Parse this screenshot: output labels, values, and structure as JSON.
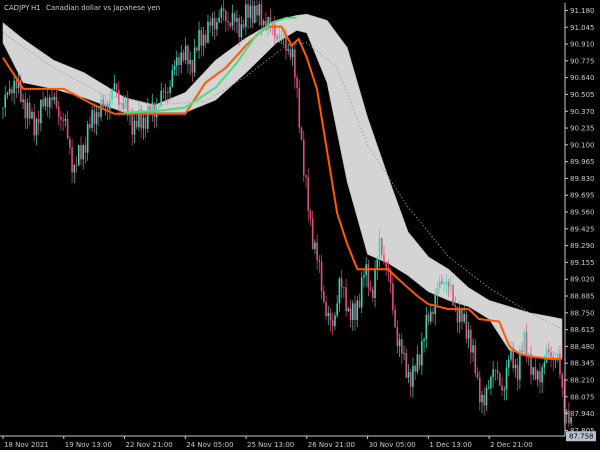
{
  "window": {
    "symbol": "CADJPY",
    "timeframe": "H1",
    "description": "Canadian dollar vs Japanese yen"
  },
  "colors": {
    "background": "#000000",
    "axis": "#c8c8c8",
    "bull_candle": "#3ad6b6",
    "bear_candle": "#e0507e",
    "cloud": "#e6e6e6",
    "upper_band": "#4fdc86",
    "lower_band": "#ff5a00",
    "mid_line": "#9a9a9a",
    "price_tag": "#b8c2ce"
  },
  "chart_data": {
    "type": "line",
    "title": "CADJPY, H1: Canadian dollar vs Japanese yen",
    "xlabel": "",
    "ylabel": "",
    "ylim": [
      87.76,
      91.24
    ],
    "grid": false,
    "y_ticks": [
      "91.180",
      "91.045",
      "90.910",
      "90.775",
      "90.640",
      "90.505",
      "90.370",
      "90.235",
      "90.100",
      "89.965",
      "89.830",
      "89.695",
      "89.560",
      "89.425",
      "89.290",
      "89.155",
      "89.020",
      "88.885",
      "88.750",
      "88.615",
      "88.480",
      "88.345",
      "88.210",
      "88.075",
      "87.940",
      "87.805"
    ],
    "x_ticks": [
      "18 Nov 2021",
      "19 Nov 13:00",
      "22 Nov 21:00",
      "24 Nov 05:00",
      "25 Nov 13:00",
      "26 Nov 21:00",
      "30 Nov 05:00",
      "1 Dec 13:00",
      "2 Dec 21:00"
    ],
    "x_positions": [
      0,
      60,
      120,
      180,
      240,
      300,
      360,
      420,
      480
    ],
    "x_max": 552,
    "current_price": "87.758",
    "series": [
      {
        "kind": "cloud_upper",
        "x": [
          0,
          20,
          50,
          80,
          120,
          150,
          180,
          210,
          240,
          270,
          290,
          300,
          320,
          340,
          360,
          380,
          400,
          420,
          440,
          460,
          480,
          500,
          520,
          540,
          552
        ],
        "values": [
          91.08,
          90.95,
          90.78,
          90.68,
          90.48,
          90.42,
          90.52,
          90.78,
          90.96,
          91.1,
          91.14,
          91.15,
          91.1,
          90.88,
          90.32,
          89.85,
          89.4,
          89.2,
          89.1,
          88.95,
          88.85,
          88.8,
          88.75,
          88.72,
          88.7
        ]
      },
      {
        "kind": "cloud_lower",
        "x": [
          0,
          20,
          50,
          80,
          120,
          150,
          180,
          210,
          240,
          270,
          290,
          300,
          320,
          340,
          360,
          380,
          400,
          420,
          440,
          460,
          480,
          500,
          520,
          540,
          552
        ],
        "values": [
          90.92,
          90.6,
          90.55,
          90.48,
          90.36,
          90.36,
          90.36,
          90.46,
          90.68,
          90.92,
          91.02,
          91.0,
          90.6,
          89.8,
          89.22,
          89.15,
          89.05,
          88.92,
          88.85,
          88.8,
          88.7,
          88.45,
          88.4,
          88.38,
          88.38
        ]
      },
      {
        "kind": "upper_band",
        "x": [
          120,
          150,
          180,
          210,
          230,
          250,
          265,
          280,
          290
        ],
        "values": [
          90.36,
          90.37,
          90.4,
          90.56,
          90.75,
          90.98,
          91.08,
          91.12,
          91.12
        ]
      },
      {
        "kind": "lower_band",
        "x": [
          0,
          20,
          30,
          60,
          90,
          110,
          130,
          160,
          180,
          200,
          220,
          240,
          260,
          275,
          285,
          292,
          300,
          310,
          320,
          330,
          340,
          350,
          360,
          380,
          400,
          410,
          420,
          440,
          460,
          470,
          490,
          500,
          510,
          520,
          540,
          552
        ],
        "values": [
          90.8,
          90.55,
          90.55,
          90.55,
          90.42,
          90.35,
          90.35,
          90.35,
          90.35,
          90.6,
          90.72,
          90.9,
          91.05,
          91.05,
          90.9,
          90.95,
          90.8,
          90.55,
          90.05,
          89.55,
          89.3,
          89.1,
          89.1,
          89.1,
          88.95,
          88.88,
          88.82,
          88.78,
          88.78,
          88.7,
          88.68,
          88.48,
          88.42,
          88.4,
          88.38,
          88.38
        ]
      },
      {
        "kind": "mid_line",
        "x": [
          0,
          50,
          100,
          150,
          200,
          240,
          280,
          300,
          330,
          360,
          400,
          440,
          480,
          520,
          552
        ],
        "values": [
          91.0,
          90.72,
          90.5,
          90.42,
          90.45,
          90.65,
          90.9,
          90.92,
          90.72,
          90.1,
          89.6,
          89.2,
          88.95,
          88.75,
          88.62
        ]
      },
      {
        "kind": "price",
        "x": [
          0,
          10,
          20,
          30,
          45,
          60,
          70,
          80,
          90,
          100,
          110,
          120,
          130,
          145,
          155,
          165,
          175,
          185,
          195,
          205,
          215,
          225,
          235,
          245,
          255,
          265,
          275,
          285,
          292,
          298,
          305,
          312,
          318,
          325,
          332,
          340,
          348,
          356,
          364,
          372,
          380,
          388,
          396,
          404,
          412,
          420,
          428,
          436,
          444,
          452,
          460,
          468,
          476,
          484,
          492,
          500,
          508,
          516,
          524,
          532,
          540,
          548,
          556,
          563
        ],
        "values": [
          90.4,
          90.62,
          90.45,
          90.25,
          90.5,
          90.3,
          89.9,
          90.1,
          90.35,
          90.4,
          90.55,
          90.4,
          90.25,
          90.35,
          90.45,
          90.6,
          90.85,
          90.75,
          90.95,
          91.05,
          91.15,
          91.1,
          91.05,
          91.2,
          91.12,
          91.05,
          90.95,
          90.85,
          90.4,
          89.8,
          89.4,
          89.1,
          88.8,
          88.6,
          89.0,
          88.8,
          88.7,
          89.1,
          88.9,
          89.3,
          89.1,
          88.6,
          88.35,
          88.2,
          88.45,
          88.7,
          88.9,
          89.05,
          88.85,
          88.7,
          88.6,
          88.2,
          88.0,
          88.35,
          88.1,
          88.4,
          88.3,
          88.55,
          88.2,
          88.3,
          88.45,
          88.35,
          87.95,
          87.76
        ]
      }
    ]
  }
}
